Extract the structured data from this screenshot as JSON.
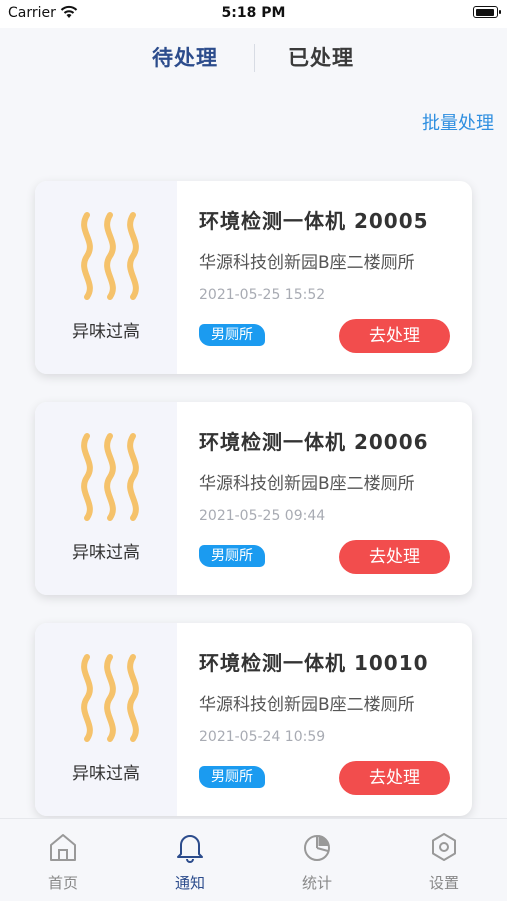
{
  "status_bar": {
    "carrier": "Carrier",
    "time": "5:18 PM"
  },
  "tabs": [
    {
      "label": "待处理",
      "active": true
    },
    {
      "label": "已处理",
      "active": false
    }
  ],
  "batch_action": "批量处理",
  "cards": [
    {
      "alert": "异味过高",
      "device": "环境检测一体机 20005",
      "location": "华源科技创新园B座二楼厕所",
      "time": "2021-05-25 15:52",
      "tag": "男厕所",
      "action": "去处理"
    },
    {
      "alert": "异味过高",
      "device": "环境检测一体机 20006",
      "location": "华源科技创新园B座二楼厕所",
      "time": "2021-05-25 09:44",
      "tag": "男厕所",
      "action": "去处理"
    },
    {
      "alert": "异味过高",
      "device": "环境检测一体机 10010",
      "location": "华源科技创新园B座二楼厕所",
      "time": "2021-05-24 10:59",
      "tag": "男厕所",
      "action": "去处理"
    }
  ],
  "nav": [
    {
      "label": "首页",
      "icon": "home-icon",
      "active": false
    },
    {
      "label": "通知",
      "icon": "bell-icon",
      "active": true
    },
    {
      "label": "统计",
      "icon": "pie-chart-icon",
      "active": false
    },
    {
      "label": "设置",
      "icon": "settings-hex-icon",
      "active": false
    }
  ],
  "colors": {
    "accent": "#2c4c8c",
    "link": "#2f8fe0",
    "danger": "#f24d4d",
    "tag": "#1b9bf0",
    "odor": "#f5c26b"
  }
}
